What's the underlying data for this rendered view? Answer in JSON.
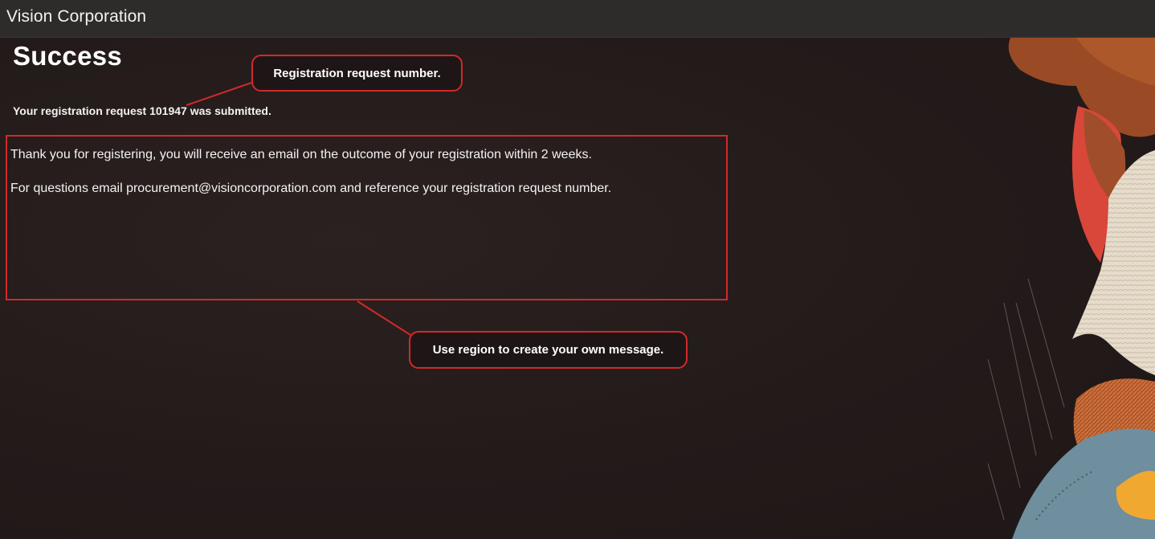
{
  "app": {
    "title": "Vision Corporation"
  },
  "page": {
    "heading": "Success",
    "confirmation": "Your registration request 101947 was submitted."
  },
  "message_region": {
    "line1": "Thank you for registering, you will receive an email on the outcome of your registration within 2 weeks.",
    "line2": "For questions email procurement@visioncorporation.com and reference your registration request number."
  },
  "callouts": {
    "request_number": "Registration request number.",
    "custom_message": "Use region to create your own message."
  },
  "colors": {
    "background": "#231a1a",
    "header": "#2e2c2b",
    "annotation_red": "#d12a2a"
  }
}
